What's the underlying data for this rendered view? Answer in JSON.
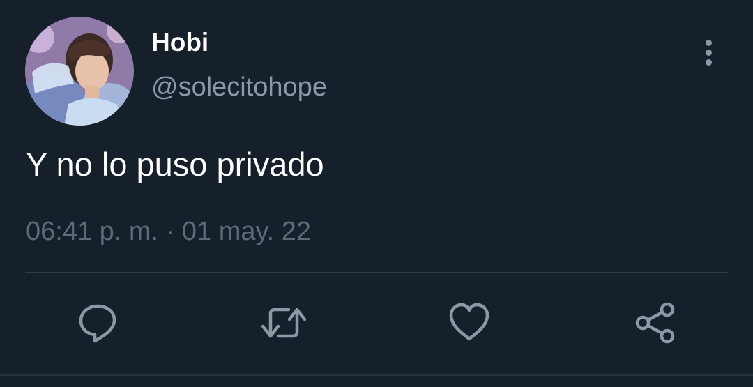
{
  "tweet": {
    "display_name": "Hobi",
    "handle": "@solecitohope",
    "text": "Y no lo puso privado",
    "timestamp": "06:41 p. m. · 01 may. 22"
  },
  "icons": {
    "more": "more-vertical-icon",
    "reply": "reply-icon",
    "retweet": "retweet-icon",
    "like": "heart-icon",
    "share": "share-icon"
  },
  "colors": {
    "background": "#15202b",
    "primary_text": "#ffffff",
    "secondary_text": "#8b98a5",
    "timestamp_text": "#5b6b7a",
    "icon": "#8b98a5",
    "divider": "#2f3b47"
  }
}
